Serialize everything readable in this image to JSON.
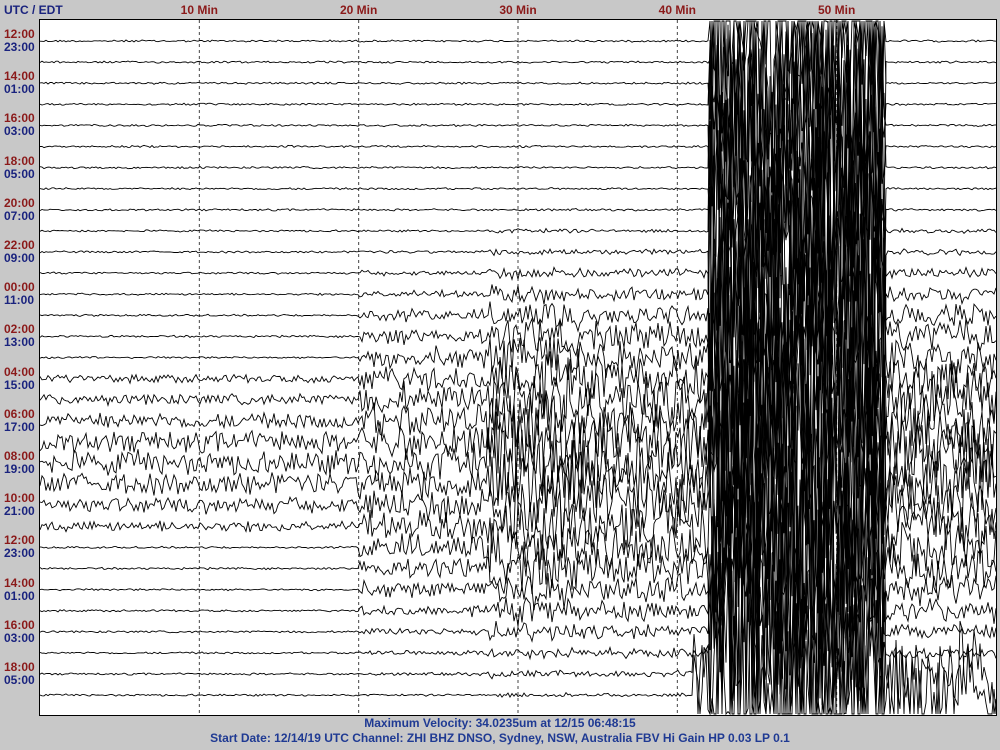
{
  "header": {
    "title": "UTC / EDT"
  },
  "minute_labels": [
    "10 Min",
    "20 Min",
    "30 Min",
    "40 Min",
    "50 Min"
  ],
  "row_labels": [
    {
      "utc": "12:00",
      "local": "23:00"
    },
    {
      "utc": "14:00",
      "local": "01:00"
    },
    {
      "utc": "16:00",
      "local": "03:00"
    },
    {
      "utc": "18:00",
      "local": "05:00"
    },
    {
      "utc": "20:00",
      "local": "07:00"
    },
    {
      "utc": "22:00",
      "local": "09:00"
    },
    {
      "utc": "00:00",
      "local": "11:00"
    },
    {
      "utc": "02:00",
      "local": "13:00"
    },
    {
      "utc": "04:00",
      "local": "15:00"
    },
    {
      "utc": "06:00",
      "local": "17:00"
    },
    {
      "utc": "08:00",
      "local": "19:00"
    },
    {
      "utc": "10:00",
      "local": "21:00"
    },
    {
      "utc": "12:00",
      "local": "23:00"
    },
    {
      "utc": "14:00",
      "local": "01:00"
    },
    {
      "utc": "16:00",
      "local": "03:00"
    },
    {
      "utc": "18:00",
      "local": "05:00"
    }
  ],
  "footer": {
    "max_velocity": "Maximum Velocity: 34.0235um at 12/15 06:48:15",
    "start_info": "Start Date: 12/14/19 UTC Channel: ZHI  BHZ  DNSO, Sydney, NSW, Australia  FBV Hi Gain HP 0.03  LP 0.1"
  },
  "chart_data": {
    "type": "line",
    "description_type": "helicorder seismogram",
    "x_axis": {
      "unit": "minutes",
      "range": [
        0,
        60
      ],
      "ticks": [
        10,
        20,
        30,
        40,
        50
      ],
      "tick_labels": [
        "10 Min",
        "20 Min",
        "30 Min",
        "40 Min",
        "50 Min"
      ],
      "grid": "dashed vertical lines at each tick"
    },
    "traces_per_hour": 1,
    "trace_count": 32,
    "trace_color": "#000000",
    "event_window_minutes": {
      "teleseismic_onset": 20,
      "surface_waves_peak": [
        42,
        52
      ]
    },
    "max_velocity_um": 34.0235,
    "max_velocity_time": "12/15 06:48:15",
    "channel": "ZHI BHZ",
    "station": "DNSO, Sydney, NSW, Australia",
    "filter": {
      "hp": 0.03,
      "lp": 0.1
    }
  }
}
